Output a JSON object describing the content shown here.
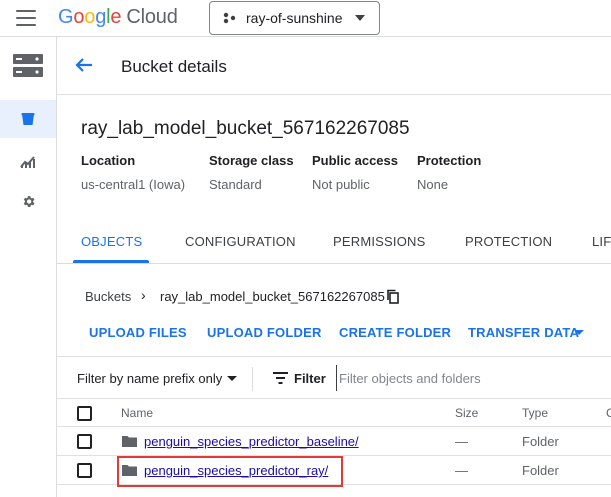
{
  "topbar": {
    "logo_letters": [
      "G",
      "o",
      "o",
      "g",
      "l",
      "e"
    ],
    "logo_product": "Cloud",
    "project_name": "ray-of-sunshine"
  },
  "rail": {
    "items": [
      {
        "icon": "storage-icon"
      },
      {
        "icon": "bucket-icon",
        "active": true
      },
      {
        "icon": "monitoring-icon"
      },
      {
        "icon": "settings-icon"
      }
    ]
  },
  "header": {
    "title": "Bucket details"
  },
  "bucket": {
    "name": "ray_lab_model_bucket_567162267085",
    "location_label": "Location",
    "location_value": "us-central1 (Iowa)",
    "storage_class_label": "Storage class",
    "storage_class_value": "Standard",
    "public_access_label": "Public access",
    "public_access_value": "Not public",
    "protection_label": "Protection",
    "protection_value": "None"
  },
  "tabs": [
    {
      "label": "OBJECTS",
      "active": true
    },
    {
      "label": "CONFIGURATION"
    },
    {
      "label": "PERMISSIONS"
    },
    {
      "label": "PROTECTION"
    },
    {
      "label": "LIFE"
    }
  ],
  "breadcrumb": {
    "root": "Buckets",
    "separator": "›",
    "current": "ray_lab_model_bucket_567162267085"
  },
  "actions": {
    "upload_files": "UPLOAD FILES",
    "upload_folder": "UPLOAD FOLDER",
    "create_folder": "CREATE FOLDER",
    "transfer_data": "TRANSFER DATA"
  },
  "filter": {
    "prefix_select": "Filter by name prefix only",
    "label": "Filter",
    "placeholder": "Filter objects and folders"
  },
  "table": {
    "columns": [
      "Name",
      "Size",
      "Type",
      "C"
    ],
    "rows": [
      {
        "name": "penguin_species_predictor_baseline/",
        "size": "—",
        "type": "Folder"
      },
      {
        "name": "penguin_species_predictor_ray/",
        "size": "—",
        "type": "Folder"
      }
    ]
  },
  "colors": {
    "accent": "#1a73e8",
    "highlight": "#e53935"
  }
}
